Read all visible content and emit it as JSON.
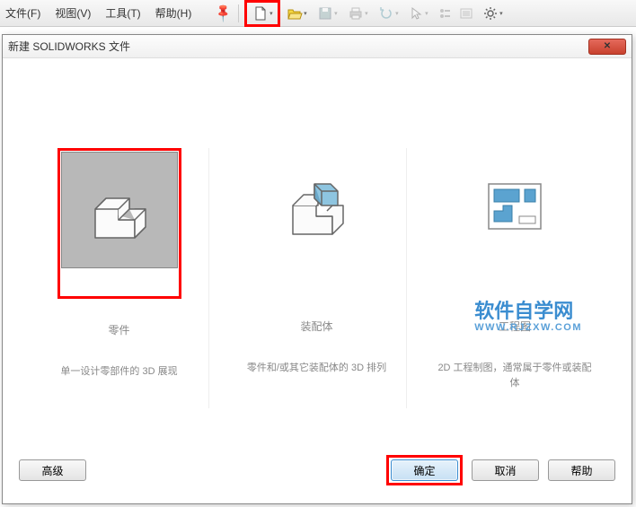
{
  "menubar": {
    "file": "文件(F)",
    "view": "视图(V)",
    "tools": "工具(T)",
    "help": "帮助(H)"
  },
  "dialog": {
    "title": "新建 SOLIDWORKS 文件",
    "options": {
      "part": {
        "title": "零件",
        "desc": "单一设计零部件的 3D 展现"
      },
      "assembly": {
        "title": "装配体",
        "desc": "零件和/或其它装配体的 3D 排列"
      },
      "drawing": {
        "title": "工程图",
        "desc": "2D 工程制图，通常属于零件或装配体"
      }
    },
    "buttons": {
      "advanced": "高级",
      "ok": "确定",
      "cancel": "取消",
      "help": "帮助"
    }
  },
  "watermark": {
    "main": "软件自学网",
    "sub": "WWW.RJZXW.COM"
  }
}
